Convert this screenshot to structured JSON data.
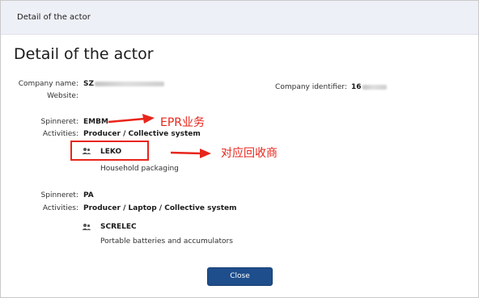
{
  "window": {
    "title": "Detail of the actor"
  },
  "modal": {
    "title": "Detail of the actor"
  },
  "company": {
    "name_label": "Company name:",
    "name_value": "SZ",
    "website_label": "Website:",
    "identifier_label": "Company identifier:",
    "identifier_value": "16"
  },
  "entries": [
    {
      "spinneret_label": "Spinneret:",
      "spinneret_value": "EMBM",
      "activities_label": "Activities:",
      "activities_value": "Producer / Collective system",
      "org_icon": "org-icon",
      "org_name": "LEKO",
      "org_description": "Household packaging"
    },
    {
      "spinneret_label": "Spinneret:",
      "spinneret_value": "PA",
      "activities_label": "Activities:",
      "activities_value": "Producer / Laptop / Collective system",
      "org_icon": "org-icon",
      "org_name": "SCRELEC",
      "org_description": "Portable batteries and accumulators"
    }
  ],
  "annotations": {
    "epr_note": "EPR业务",
    "recycler_note": "对应回收商",
    "color": "#e8251b"
  },
  "footer": {
    "close_label": "Close"
  },
  "colors": {
    "titlebar_bg": "#eef0f7",
    "button_bg": "#1f4e8c",
    "annotation_red": "#e8251b"
  }
}
